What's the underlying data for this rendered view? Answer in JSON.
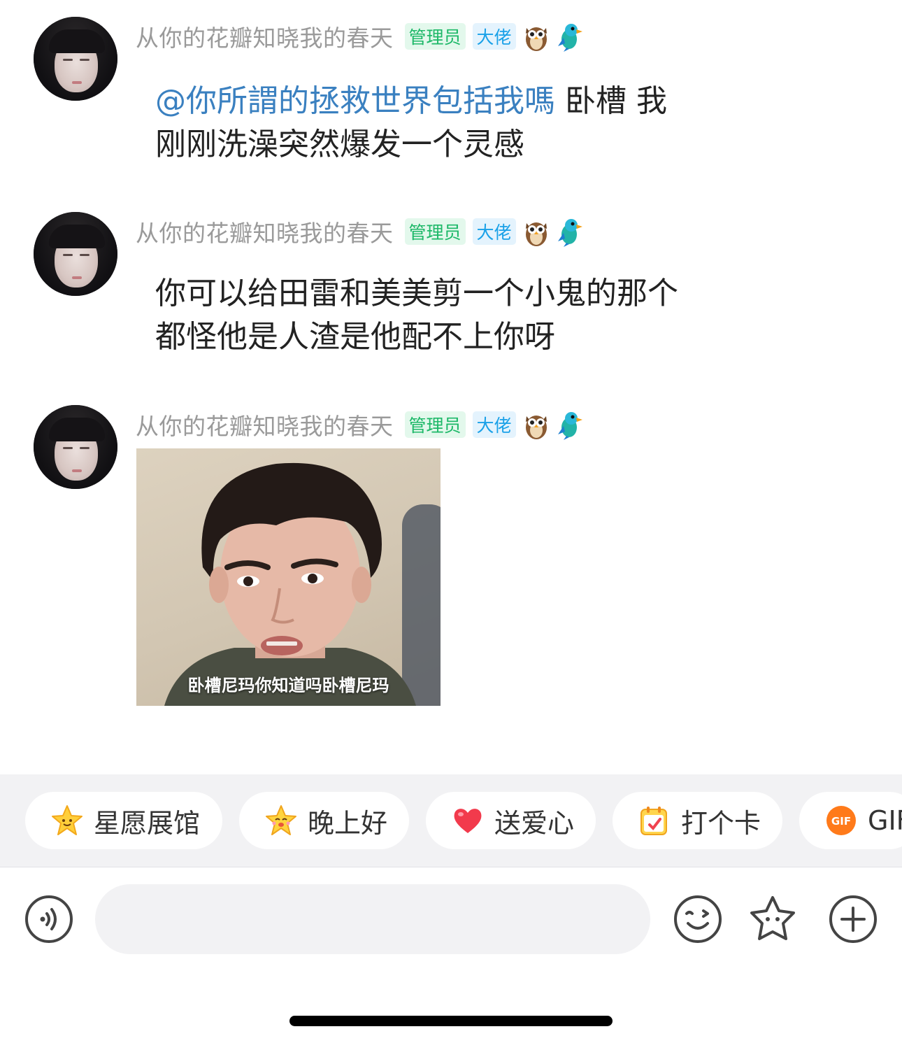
{
  "messages": [
    {
      "username": "从你的花瓣知晓我的春天",
      "badges": {
        "admin": "管理员",
        "level": "大佬"
      },
      "icons": [
        "owl-icon",
        "parrot-icon"
      ],
      "mention": "@你所謂的拯救世界包括我嗎",
      "text_line1": " 卧槽 我",
      "text_line2": "刚刚洗澡突然爆发一个灵感"
    },
    {
      "username": "从你的花瓣知晓我的春天",
      "badges": {
        "admin": "管理员",
        "level": "大佬"
      },
      "icons": [
        "owl-icon",
        "parrot-icon"
      ],
      "text_line1": "你可以给田雷和美美剪一个小鬼的那个",
      "text_line2": "都怪他是人渣是他配不上你呀"
    },
    {
      "username": "从你的花瓣知晓我的春天",
      "badges": {
        "admin": "管理员",
        "level": "大佬"
      },
      "icons": [
        "owl-icon",
        "parrot-icon"
      ],
      "sticker_caption": "卧槽尼玛你知道吗卧槽尼玛"
    }
  ],
  "quick_actions": [
    {
      "label": "星愿展馆",
      "icon": "star-smile-icon"
    },
    {
      "label": "晚上好",
      "icon": "star-face-icon"
    },
    {
      "label": "送爱心",
      "icon": "heart-icon"
    },
    {
      "label": "打个卡",
      "icon": "calendar-icon"
    },
    {
      "label": "GIF",
      "icon": "gif-icon"
    }
  ],
  "input": {
    "placeholder": "",
    "buttons": [
      "voice-icon",
      "emoji-icon",
      "star-sticker-icon",
      "plus-icon"
    ]
  },
  "colors": {
    "username": "#9a9a9a",
    "admin_badge_text": "#1db868",
    "admin_badge_bg": "#e3f8ec",
    "level_badge_text": "#1aa1e8",
    "level_badge_bg": "#e4f3fd",
    "mention": "#3a80c0",
    "text": "#222222",
    "quickbar_bg": "#f2f2f4"
  }
}
